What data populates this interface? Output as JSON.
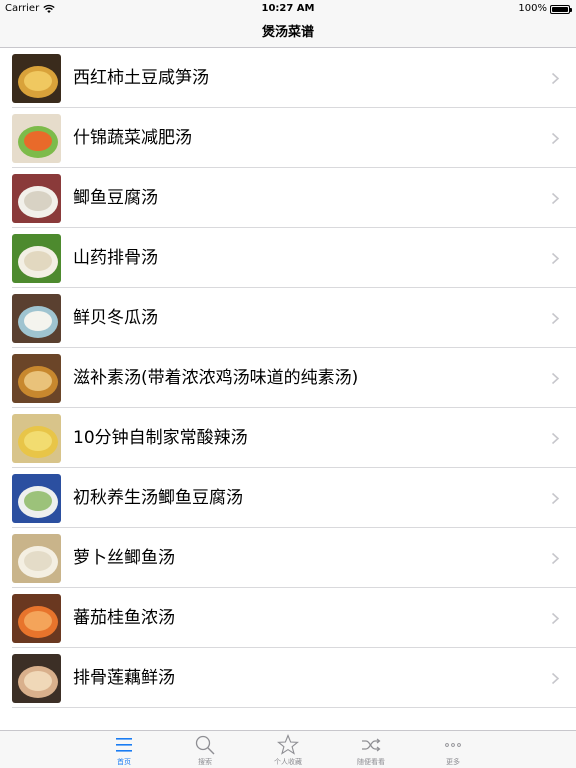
{
  "status_bar": {
    "carrier": "Carrier",
    "time": "10:27 AM",
    "battery": "100%"
  },
  "nav": {
    "title": "煲汤菜谱"
  },
  "recipes": [
    {
      "name": "西红柿土豆咸笋汤"
    },
    {
      "name": "什锦蔬菜减肥汤"
    },
    {
      "name": "鲫鱼豆腐汤"
    },
    {
      "name": "山药排骨汤"
    },
    {
      "name": "鲜贝冬瓜汤"
    },
    {
      "name": "滋补素汤(带着浓浓鸡汤味道的纯素汤)"
    },
    {
      "name": "10分钟自制家常酸辣汤"
    },
    {
      "name": "初秋养生汤鲫鱼豆腐汤"
    },
    {
      "name": "萝卜丝鲫鱼汤"
    },
    {
      "name": "蕃茄桂鱼浓汤"
    },
    {
      "name": "排骨莲藕鲜汤"
    }
  ],
  "tabs": [
    {
      "label": "首页",
      "icon": "list-icon",
      "active": true
    },
    {
      "label": "搜索",
      "icon": "search-icon",
      "active": false
    },
    {
      "label": "个人收藏",
      "icon": "star-icon",
      "active": false
    },
    {
      "label": "随便看看",
      "icon": "shuffle-icon",
      "active": false
    },
    {
      "label": "更多",
      "icon": "more-icon",
      "active": false
    }
  ],
  "colors": {
    "accent": "#1a7cf3",
    "inactive": "#8e8e93",
    "bar_background": "#f7f7f7",
    "separator": "#d9d9dc"
  }
}
